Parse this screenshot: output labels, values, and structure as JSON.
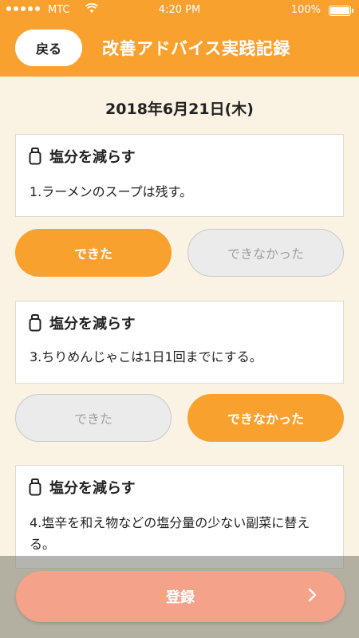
{
  "status": {
    "carrier": "MTC",
    "time": "4:20 PM",
    "battery": "100%"
  },
  "nav": {
    "back_label": "戻る",
    "title": "改善アドバイス実践記録"
  },
  "date": "2018年6月21日(木)",
  "items": [
    {
      "category": "塩分を減らす",
      "text": "1.ラーメンのスープは残す。",
      "done_label": "できた",
      "not_done_label": "できなかった",
      "selected": "done"
    },
    {
      "category": "塩分を減らす",
      "text": "3.ちりめんじゃこは1日1回までにする。",
      "done_label": "できた",
      "not_done_label": "できなかった",
      "selected": "not_done"
    },
    {
      "category": "塩分を減らす",
      "text": "4.塩辛を和え物などの塩分量の少ない副菜に替える。"
    }
  ],
  "footer": {
    "register_label": "登録"
  },
  "colors": {
    "accent": "#f9a12f",
    "background": "#faf3e3",
    "register": "#f4a28a"
  }
}
